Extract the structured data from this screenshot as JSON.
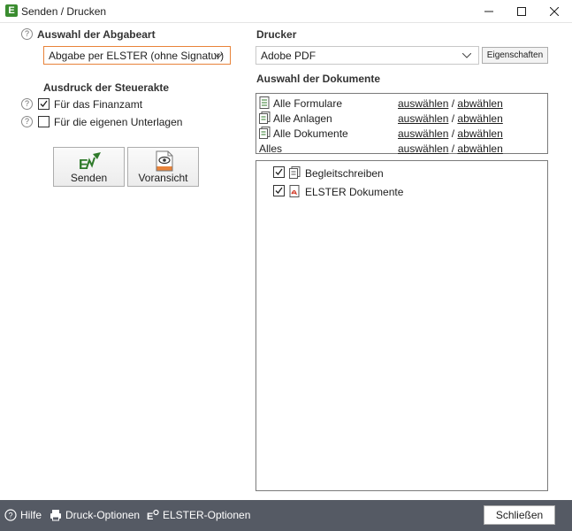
{
  "window": {
    "app_letter": "E",
    "title": "Senden / Drucken"
  },
  "left": {
    "abgabeart_label": "Auswahl der Abgabeart",
    "abgabeart_value": "Abgabe per ELSTER (ohne Signatur)",
    "ausdruck_label": "Ausdruck der Steuerakte",
    "options": [
      {
        "label": "Für das Finanzamt",
        "checked": true
      },
      {
        "label": "Für die eigenen Unterlagen",
        "checked": false
      }
    ],
    "buttons": {
      "senden": "Senden",
      "voransicht": "Voransicht"
    }
  },
  "right": {
    "drucker_label": "Drucker",
    "drucker_value": "Adobe PDF",
    "eigenschaften_label": "Eigenschaften",
    "dokumente_label": "Auswahl der Dokumente",
    "doc_rows": [
      {
        "label": "Alle Formulare",
        "select": "auswählen",
        "sep": "/",
        "deselect": "abwählen"
      },
      {
        "label": "Alle Anlagen",
        "select": "auswählen",
        "sep": "/",
        "deselect": "abwählen"
      },
      {
        "label": "Alle Dokumente",
        "select": "auswählen",
        "sep": "/",
        "deselect": "abwählen"
      },
      {
        "label": "Alles",
        "select": "auswählen",
        "sep": "/",
        "deselect": "abwählen"
      }
    ],
    "tree_items": [
      {
        "label": "Begleitschreiben",
        "checked": true
      },
      {
        "label": "ELSTER Dokumente",
        "checked": true
      }
    ]
  },
  "footer": {
    "hilfe": "Hilfe",
    "druck_optionen": "Druck-Optionen",
    "elster_optionen": "ELSTER-Optionen",
    "schliessen": "Schließen"
  },
  "colors": {
    "accent_orange": "#e8833a",
    "footer_bg": "#555a64",
    "app_green": "#3a8c2f"
  }
}
